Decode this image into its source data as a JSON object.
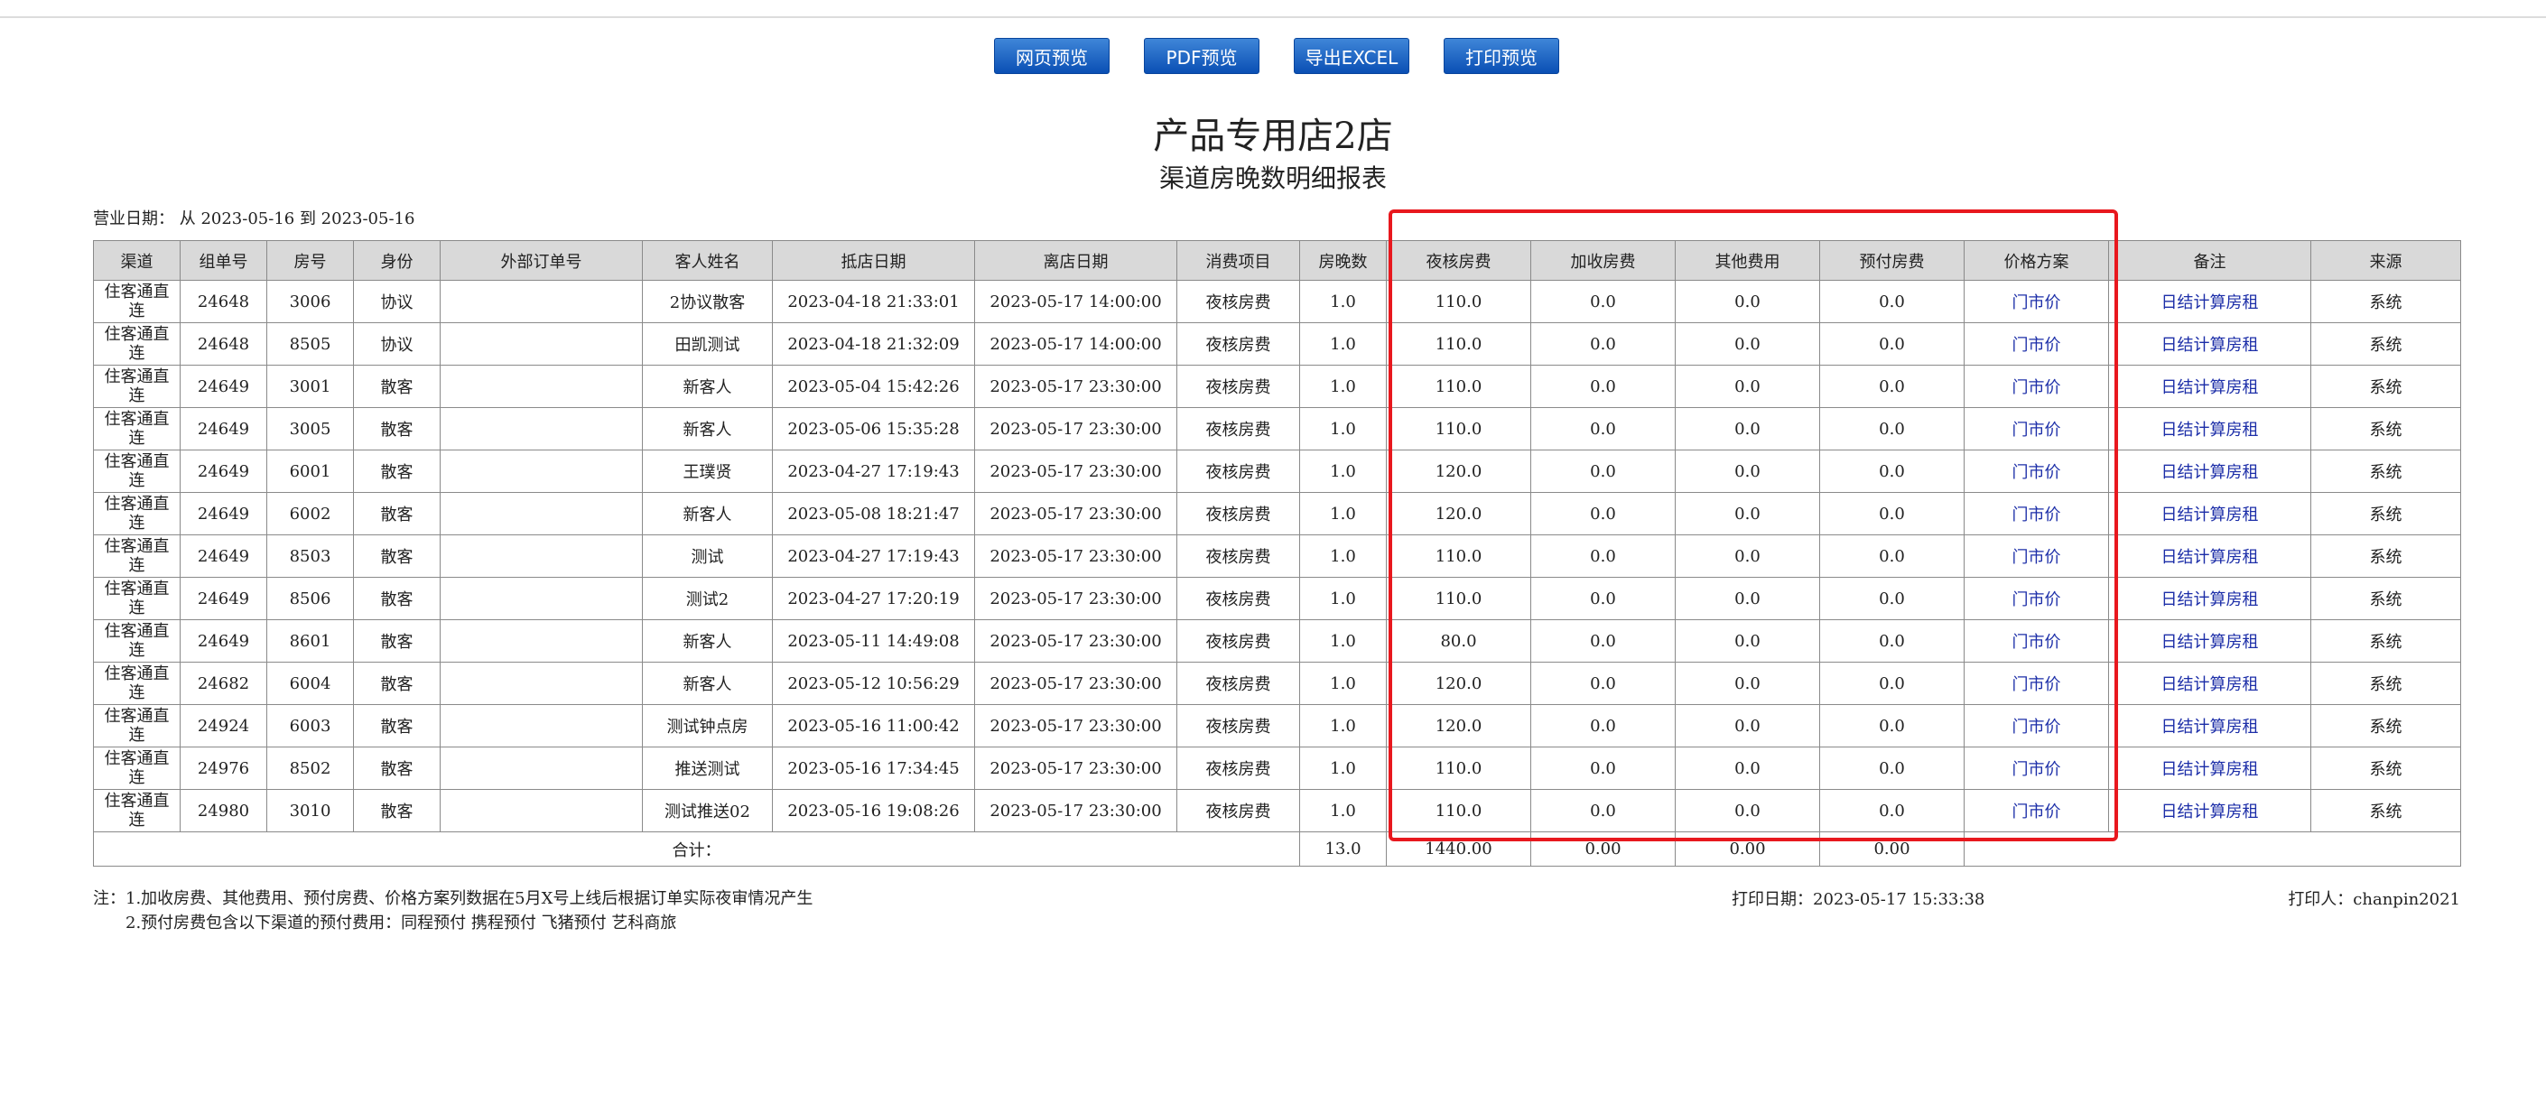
{
  "toolbar": {
    "web_preview": "网页预览",
    "pdf_preview": "PDF预览",
    "export_excel": "导出EXCEL",
    "print_preview": "打印预览"
  },
  "report": {
    "hotel_name": "产品专用店2店",
    "title": "渠道房晚数明细报表",
    "business_date": "营业日期： 从 2023-05-16 到 2023-05-16"
  },
  "table": {
    "headers": [
      "渠道",
      "组单号",
      "房号",
      "身份",
      "外部订单号",
      "客人姓名",
      "抵店日期",
      "离店日期",
      "消费项目",
      "房晚数",
      "夜核房费",
      "加收房费",
      "其他费用",
      "预付房费",
      "价格方案",
      "备注",
      "来源"
    ],
    "rows": [
      [
        "住客通直连",
        "24648",
        "3006",
        "协议",
        "",
        "2协议散客",
        "2023-04-18 21:33:01",
        "2023-05-17 14:00:00",
        "夜核房费",
        "1.0",
        "110.0",
        "0.0",
        "0.0",
        "0.0",
        "门市价",
        "日结计算房租",
        "系统"
      ],
      [
        "住客通直连",
        "24648",
        "8505",
        "协议",
        "",
        "田凯测试",
        "2023-04-18 21:32:09",
        "2023-05-17 14:00:00",
        "夜核房费",
        "1.0",
        "110.0",
        "0.0",
        "0.0",
        "0.0",
        "门市价",
        "日结计算房租",
        "系统"
      ],
      [
        "住客通直连",
        "24649",
        "3001",
        "散客",
        "",
        "新客人",
        "2023-05-04 15:42:26",
        "2023-05-17 23:30:00",
        "夜核房费",
        "1.0",
        "110.0",
        "0.0",
        "0.0",
        "0.0",
        "门市价",
        "日结计算房租",
        "系统"
      ],
      [
        "住客通直连",
        "24649",
        "3005",
        "散客",
        "",
        "新客人",
        "2023-05-06 15:35:28",
        "2023-05-17 23:30:00",
        "夜核房费",
        "1.0",
        "110.0",
        "0.0",
        "0.0",
        "0.0",
        "门市价",
        "日结计算房租",
        "系统"
      ],
      [
        "住客通直连",
        "24649",
        "6001",
        "散客",
        "",
        "王璞贤",
        "2023-04-27 17:19:43",
        "2023-05-17 23:30:00",
        "夜核房费",
        "1.0",
        "120.0",
        "0.0",
        "0.0",
        "0.0",
        "门市价",
        "日结计算房租",
        "系统"
      ],
      [
        "住客通直连",
        "24649",
        "6002",
        "散客",
        "",
        "新客人",
        "2023-05-08 18:21:47",
        "2023-05-17 23:30:00",
        "夜核房费",
        "1.0",
        "120.0",
        "0.0",
        "0.0",
        "0.0",
        "门市价",
        "日结计算房租",
        "系统"
      ],
      [
        "住客通直连",
        "24649",
        "8503",
        "散客",
        "",
        "测试",
        "2023-04-27 17:19:43",
        "2023-05-17 23:30:00",
        "夜核房费",
        "1.0",
        "110.0",
        "0.0",
        "0.0",
        "0.0",
        "门市价",
        "日结计算房租",
        "系统"
      ],
      [
        "住客通直连",
        "24649",
        "8506",
        "散客",
        "",
        "测试2",
        "2023-04-27 17:20:19",
        "2023-05-17 23:30:00",
        "夜核房费",
        "1.0",
        "110.0",
        "0.0",
        "0.0",
        "0.0",
        "门市价",
        "日结计算房租",
        "系统"
      ],
      [
        "住客通直连",
        "24649",
        "8601",
        "散客",
        "",
        "新客人",
        "2023-05-11 14:49:08",
        "2023-05-17 23:30:00",
        "夜核房费",
        "1.0",
        "80.0",
        "0.0",
        "0.0",
        "0.0",
        "门市价",
        "日结计算房租",
        "系统"
      ],
      [
        "住客通直连",
        "24682",
        "6004",
        "散客",
        "",
        "新客人",
        "2023-05-12 10:56:29",
        "2023-05-17 23:30:00",
        "夜核房费",
        "1.0",
        "120.0",
        "0.0",
        "0.0",
        "0.0",
        "门市价",
        "日结计算房租",
        "系统"
      ],
      [
        "住客通直连",
        "24924",
        "6003",
        "散客",
        "",
        "测试钟点房",
        "2023-05-16 11:00:42",
        "2023-05-17 23:30:00",
        "夜核房费",
        "1.0",
        "120.0",
        "0.0",
        "0.0",
        "0.0",
        "门市价",
        "日结计算房租",
        "系统"
      ],
      [
        "住客通直连",
        "24976",
        "8502",
        "散客",
        "",
        "推送测试",
        "2023-05-16 17:34:45",
        "2023-05-17 23:30:00",
        "夜核房费",
        "1.0",
        "110.0",
        "0.0",
        "0.0",
        "0.0",
        "门市价",
        "日结计算房租",
        "系统"
      ],
      [
        "住客通直连",
        "24980",
        "3010",
        "散客",
        "",
        "测试推送02",
        "2023-05-16 19:08:26",
        "2023-05-17 23:30:00",
        "夜核房费",
        "1.0",
        "110.0",
        "0.0",
        "0.0",
        "0.0",
        "门市价",
        "日结计算房租",
        "系统"
      ]
    ],
    "total": {
      "label": "合计：",
      "room_nights": "13.0",
      "night_audit_fee": "1440.00",
      "extra_fee": "0.00",
      "other_fee": "0.00",
      "prepaid_fee": "0.00"
    }
  },
  "footer": {
    "note_1": "注：1.加收房费、其他费用、预付房费、价格方案列数据在5月X号上线后根据订单实际夜审情况产生",
    "note_2": "2.预付房费包含以下渠道的预付费用：同程预付 携程预付 飞猪预付 艺科商旅",
    "print_date": "打印日期：2023-05-17 15:33:38",
    "printer": "打印人：chanpin2021"
  },
  "colors": {
    "button": "#1a5fc4",
    "highlight_box": "#e8181e",
    "header_bg": "#d9d9d9",
    "link_text": "#1c2ea8"
  }
}
